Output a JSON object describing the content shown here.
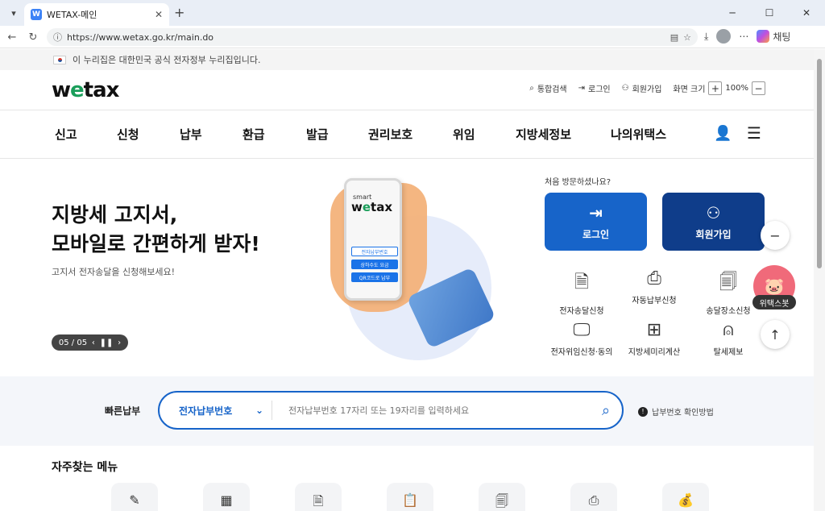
{
  "browser": {
    "tab_title": "WETAX-메인",
    "url": "https://www.wetax.go.kr/main.do",
    "copilot_label": "채팅"
  },
  "gov_banner": "이 누리집은 대한민국 공식 전자정부 누리집입니다.",
  "logo": {
    "pre": "w",
    "e": "e",
    "post": "tax"
  },
  "util": {
    "search": "통합검색",
    "login": "로그인",
    "join": "회원가입",
    "screen_size": "화면 크기",
    "zoom": "100%"
  },
  "gnb": [
    "신고",
    "신청",
    "납부",
    "환급",
    "발급",
    "권리보호",
    "위임",
    "지방세정보",
    "나의위택스"
  ],
  "hero": {
    "title_line1": "지방세 고지서,",
    "title_line2": "모바일로 간편하게 받자!",
    "subtitle": "고지서 전자송달을 신청해보세요!",
    "slide_counter": "05 / 05",
    "phone_smart": "smart",
    "phone_buttons": [
      "전자납부번호",
      "상하수도 요금",
      "QR코드로 납부"
    ]
  },
  "first_visit": "처음 방문하셨나요?",
  "big_buttons": {
    "login": "로그인",
    "join": "회원가입"
  },
  "services": [
    "전자송달신청",
    "자동납부신청",
    "송달장소신청",
    "전자위임신청·동의",
    "지방세미리계산",
    "탈세제보"
  ],
  "bot_label": "위택스봇",
  "quickpay": {
    "label": "빠른납부",
    "select": "전자납부번호",
    "placeholder": "전자납부번호 17자리 또는 19자리를 입력하세요",
    "help": "납부번호 확인방법"
  },
  "faq_title": "자주찾는 메뉴"
}
